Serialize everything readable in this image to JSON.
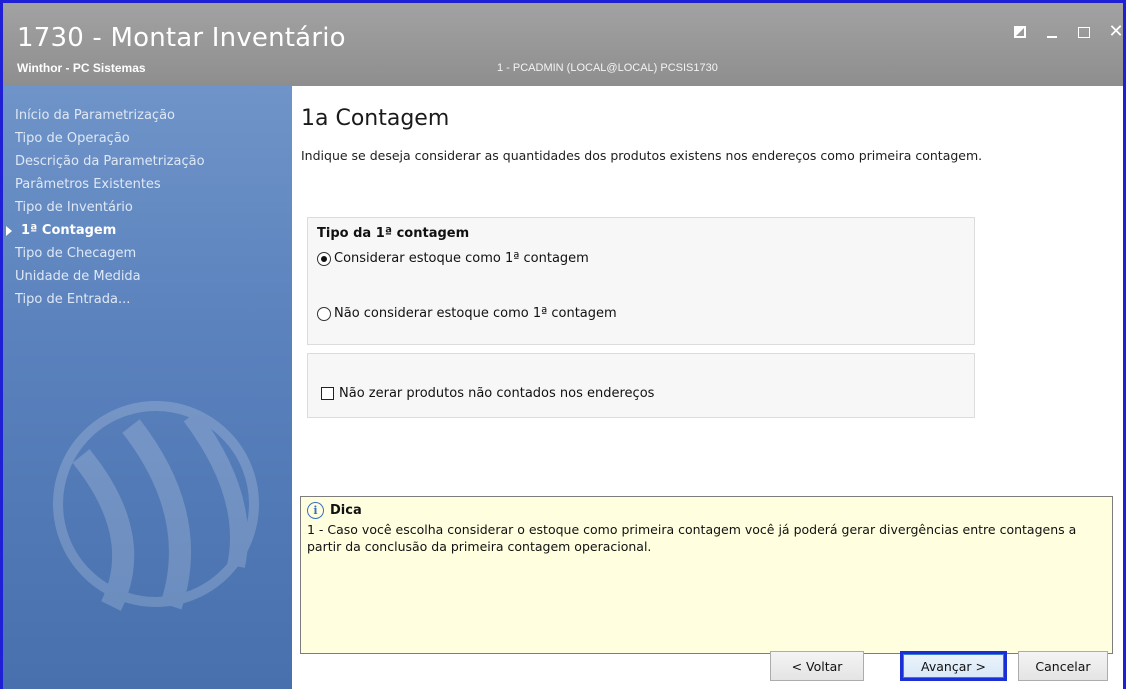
{
  "window": {
    "title": "1730 - Montar Inventário",
    "subtitle": "Winthor - PC Sistemas",
    "user_info": "1 - PCADMIN (LOCAL@LOCAL)   PCSIS1730",
    "controls": {
      "restore": "restore-icon",
      "minimize": "minimize-icon",
      "maximize": "maximize-icon",
      "close": "✕"
    }
  },
  "sidebar": {
    "items": [
      {
        "label": "Início da Parametrização",
        "active": false
      },
      {
        "label": "Tipo de Operação",
        "active": false
      },
      {
        "label": "Descrição da Parametrização",
        "active": false
      },
      {
        "label": "Parâmetros Existentes",
        "active": false
      },
      {
        "label": "Tipo de Inventário",
        "active": false
      },
      {
        "label": "1ª Contagem",
        "active": true
      },
      {
        "label": "Tipo de Checagem",
        "active": false
      },
      {
        "label": "Unidade de Medida",
        "active": false
      },
      {
        "label": "Tipo de Entrada...",
        "active": false
      }
    ]
  },
  "main": {
    "title": "1a Contagem",
    "description": "Indique se deseja considerar as quantidades dos produtos existens nos endereços como primeira contagem.",
    "group1": {
      "title": "Tipo da 1ª contagem",
      "options": [
        {
          "label": "Considerar estoque como 1ª contagem",
          "checked": true
        },
        {
          "label": "Não considerar estoque como 1ª contagem",
          "checked": false
        }
      ]
    },
    "group2": {
      "checkbox_label": "Não zerar produtos não contados nos endereços",
      "checked": false
    },
    "tip": {
      "icon": "info-icon",
      "title": "Dica",
      "text": "1 - Caso você escolha considerar o estoque como primeira contagem você já poderá gerar divergências entre contagens a partir da conclusão da primeira contagem operacional."
    },
    "buttons": {
      "back": "< Voltar",
      "next": "Avançar >",
      "cancel": "Cancelar"
    }
  },
  "colors": {
    "title_bar": "#9a9a9a",
    "sidebar": "#5b82bd",
    "tip_background": "#ffffe0",
    "focus_border": "#1b2fd6"
  }
}
